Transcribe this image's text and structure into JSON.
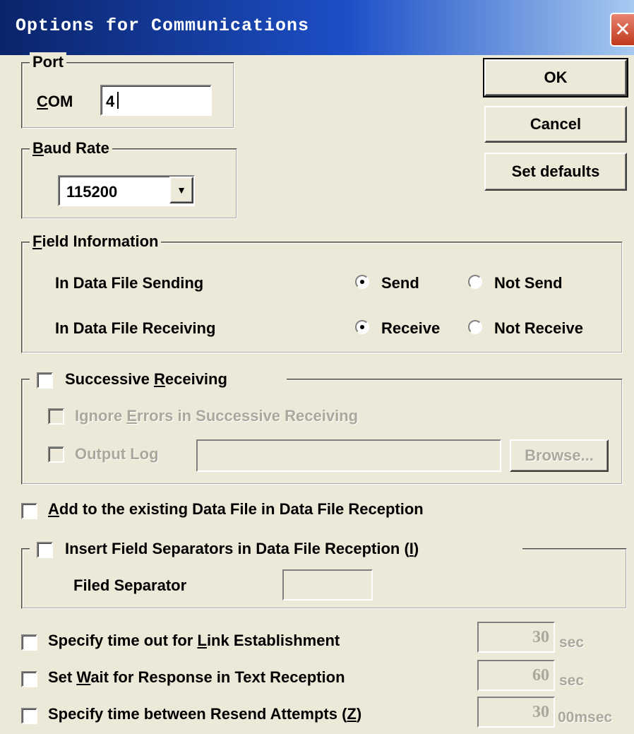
{
  "window": {
    "title": "Options for Communications",
    "close_glyph": "✕"
  },
  "buttons": {
    "ok": "OK",
    "cancel": "Cancel",
    "set_defaults": "Set defaults",
    "browse": "Browse..."
  },
  "port": {
    "group_label": "Port",
    "com_prefix": "C",
    "com_rest": "OM",
    "com_value": "4"
  },
  "baud": {
    "label_u": "B",
    "label_rest": "aud Rate",
    "selected": "115200",
    "arrow": "▼"
  },
  "field_info": {
    "label_u": "F",
    "label_rest": "ield Information",
    "sending_label": "In Data File Sending",
    "send": "Send",
    "not_send": "Not Send",
    "receiving_label": "In Data File Receiving",
    "receive": "Receive",
    "not_receive": "Not Receive"
  },
  "successive": {
    "label_pre": "Successive ",
    "label_u": "R",
    "label_rest": "eceiving",
    "ignore_pre": "Ignore ",
    "ignore_u": "E",
    "ignore_rest": "rrors in Successive Receiving",
    "output_log": "Output Log"
  },
  "add_existing": {
    "label_u": "A",
    "label_rest": "dd to the existing Data File in Data File Reception"
  },
  "insert_sep": {
    "label_pre": "Insert Field Separators in Data File Reception (",
    "label_u": "I",
    "label_post": ")",
    "separator_label": "Filed Separator"
  },
  "timeouts": {
    "link_pre": "Specify time out for ",
    "link_u": "L",
    "link_rest": "ink Establishment",
    "link_value": "30",
    "link_unit": "sec",
    "wait_pre": "Set ",
    "wait_u": "W",
    "wait_rest": "ait for Response in Text Reception",
    "wait_value": "60",
    "wait_unit": "sec",
    "resend_pre": "Specify time between Resend Attempts (",
    "resend_u": "Z",
    "resend_post": ")",
    "resend_value": "30",
    "resend_unit": "00msec"
  }
}
